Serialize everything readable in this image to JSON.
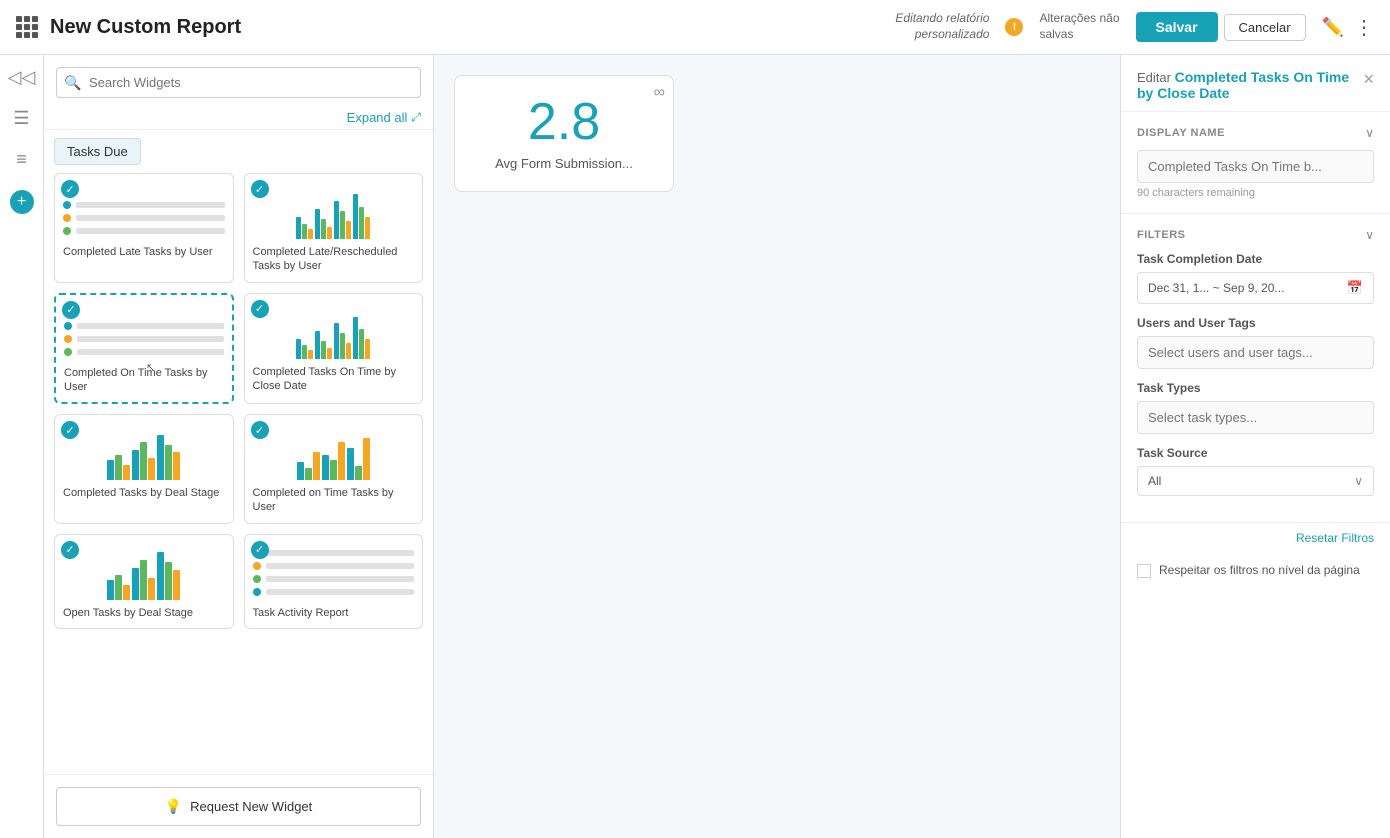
{
  "header": {
    "app_icon": "grid-icon",
    "title": "New Custom Report",
    "editing_label_line1": "Editando relatório",
    "editing_label_line2": "personalizado",
    "warning_text": "!",
    "unsaved_line1": "Alterações não",
    "unsaved_line2": "salvas",
    "btn_save": "Salvar",
    "btn_cancel": "Cancelar"
  },
  "left_nav": {
    "icons": [
      "≡≡",
      "≡",
      "≡≡",
      "+"
    ]
  },
  "widget_panel": {
    "search_placeholder": "Search Widgets",
    "expand_all": "Expand all",
    "tasks_due_chip": "Tasks Due",
    "widgets": [
      {
        "id": "completed-late-tasks",
        "label": "Completed Late Tasks by User",
        "checked": true,
        "selected": false,
        "type": "bar"
      },
      {
        "id": "completed-late-rescheduled",
        "label": "Completed Late/Rescheduled Tasks by User",
        "checked": true,
        "selected": false,
        "type": "bar"
      },
      {
        "id": "completed-on-time-tasks-user",
        "label": "Completed On Time Tasks by User",
        "checked": true,
        "selected": true,
        "type": "bar"
      },
      {
        "id": "completed-tasks-on-time-close",
        "label": "Completed Tasks On Time by Close Date",
        "checked": true,
        "selected": false,
        "type": "bar"
      },
      {
        "id": "completed-tasks-deal-stage",
        "label": "Completed Tasks by Deal Stage",
        "checked": true,
        "selected": false,
        "type": "bar2"
      },
      {
        "id": "completed-on-time-tasks-user2",
        "label": "Completed on Time Tasks by User",
        "checked": true,
        "selected": false,
        "type": "bar3"
      },
      {
        "id": "open-tasks-deal-stage",
        "label": "Open Tasks by Deal Stage",
        "checked": true,
        "selected": false,
        "type": "bar2"
      },
      {
        "id": "task-activity-report",
        "label": "Task Activity Report",
        "checked": true,
        "selected": false,
        "type": "list"
      }
    ],
    "add_widget_btn": "Request New Widget"
  },
  "canvas": {
    "widget": {
      "value": "2.8",
      "label": "Avg Form Submission...",
      "menu": "∞"
    }
  },
  "edit_panel": {
    "title_prefix": "Editar ",
    "title_name": "Completed Tasks On Time by Close Date",
    "close_btn": "×",
    "display_name_section": {
      "title": "DISPLAY NAME",
      "placeholder": "Completed Tasks On Time b...",
      "chars_remaining": "90 characters remaining"
    },
    "filters_section": {
      "title": "FILTERS",
      "task_completion_date_label": "Task Completion Date",
      "date_range": "Dec 31, 1...  ~  Sep 9, 20...",
      "users_tags_label": "Users and User Tags",
      "users_placeholder": "Select users and user tags...",
      "task_types_label": "Task Types",
      "task_types_placeholder": "Select task types...",
      "task_source_label": "Task Source",
      "task_source_value": "All",
      "reset_btn": "Resetar Filtros",
      "checkbox_label": "Respeitar os filtros no nível da página"
    }
  }
}
